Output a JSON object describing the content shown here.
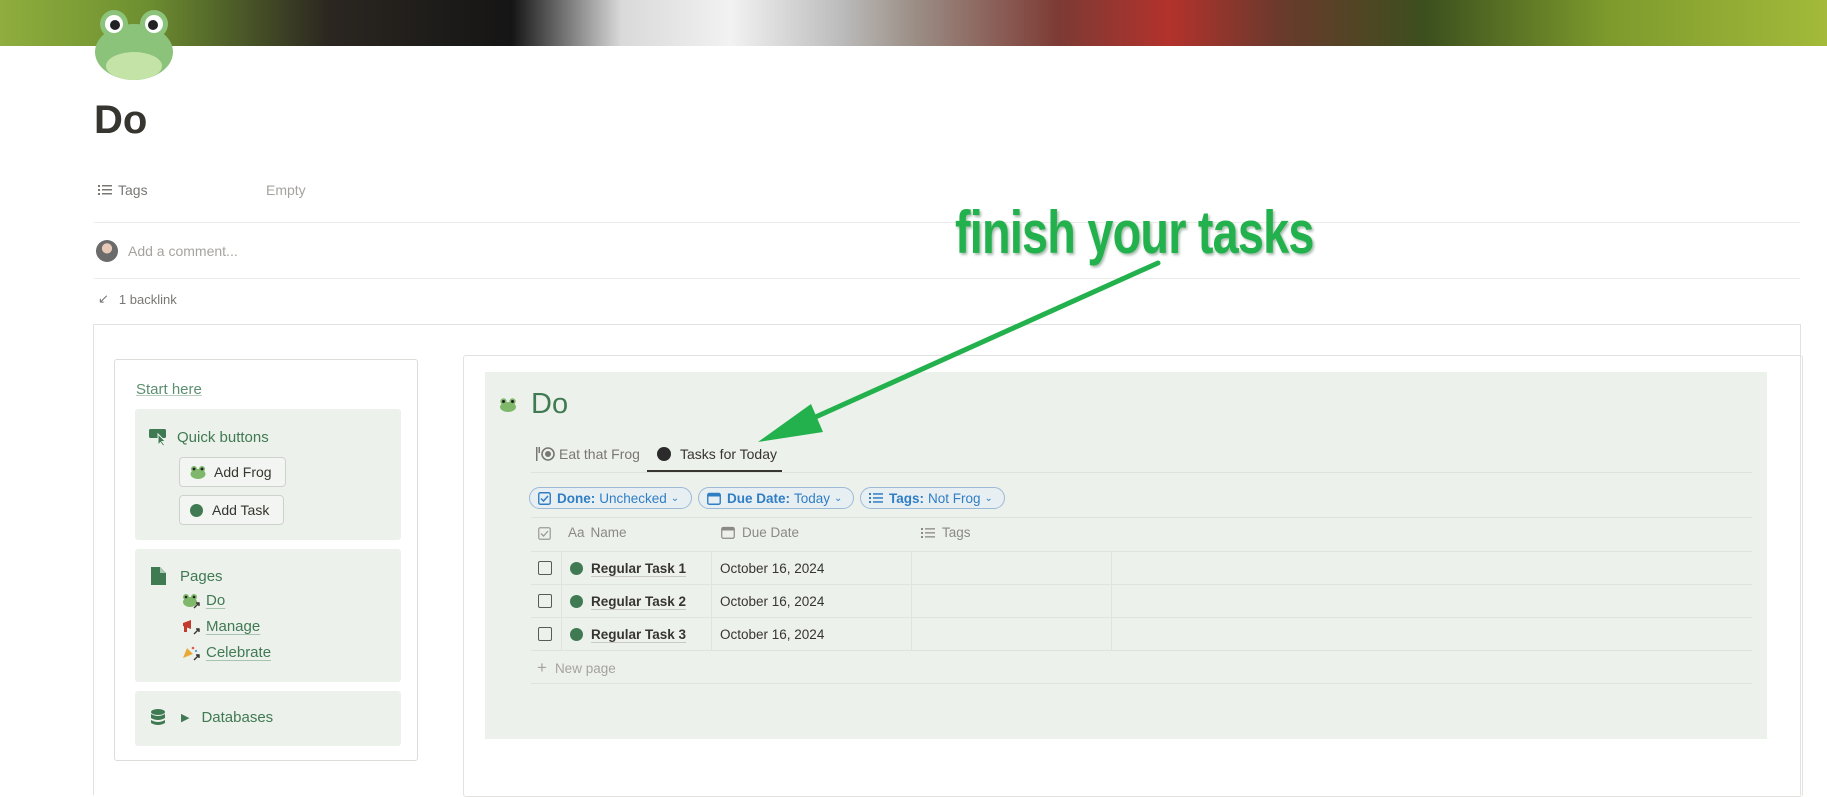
{
  "page": {
    "title": "Do",
    "property": {
      "name": "Tags",
      "value": "Empty"
    },
    "comment_placeholder": "Add a comment...",
    "backlinks": "1 backlink"
  },
  "left_panel": {
    "start_here": "Start here",
    "quick_buttons": {
      "heading": "Quick buttons",
      "buttons": [
        {
          "label": "Add Frog",
          "icon": "frog-icon"
        },
        {
          "label": "Add Task",
          "icon": "green-circle-icon"
        }
      ]
    },
    "pages": {
      "heading": "Pages",
      "links": [
        {
          "label": "Do",
          "icon": "frog-icon"
        },
        {
          "label": "Manage",
          "icon": "megaphone-icon"
        },
        {
          "label": "Celebrate",
          "icon": "party-icon"
        }
      ]
    },
    "databases": {
      "heading": "Databases",
      "collapsed": true
    }
  },
  "database": {
    "title": "Do",
    "tabs": [
      {
        "label": "Eat that Frog",
        "icon": "fork-plate-icon",
        "active": false
      },
      {
        "label": "Tasks for Today",
        "icon": "black-circle-icon",
        "active": true
      }
    ],
    "filters": [
      {
        "name": "Done:",
        "value": "Unchecked",
        "icon": "checkbox-icon"
      },
      {
        "name": "Due Date:",
        "value": "Today",
        "icon": "calendar-icon"
      },
      {
        "name": "Tags:",
        "value": "Not Frog",
        "icon": "list-icon"
      }
    ],
    "columns": {
      "name_prefix": "Aa",
      "name": "Name",
      "due_date": "Due Date",
      "tags": "Tags"
    },
    "rows": [
      {
        "name": "Regular Task 1",
        "due_date": "October 16, 2024",
        "tags": "",
        "done": false
      },
      {
        "name": "Regular Task 2",
        "due_date": "October 16, 2024",
        "tags": "",
        "done": false
      },
      {
        "name": "Regular Task 3",
        "due_date": "October 16, 2024",
        "tags": "",
        "done": false
      }
    ],
    "new_page": "New page"
  },
  "annotation": {
    "text": "finish your tasks",
    "color": "#22b14c"
  },
  "colors": {
    "accent_green": "#3f7a52",
    "panel_bg": "#edf1ec",
    "filter_blue": "#2f7ec4"
  }
}
